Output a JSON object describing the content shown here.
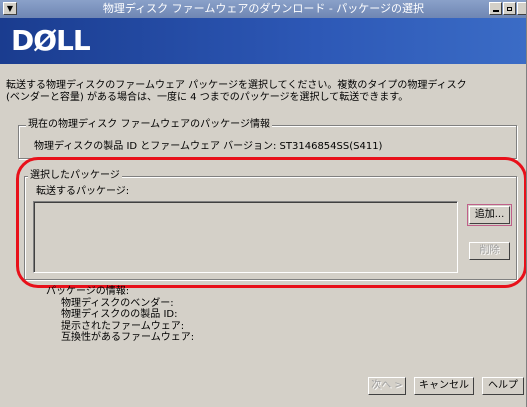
{
  "window": {
    "title": "物理ディスク ファームウェアのダウンロード - パッケージの選択",
    "system_menu_icon": "chevron-down-icon",
    "controls": [
      "minimize-icon",
      "maximize-icon"
    ]
  },
  "banner": {
    "logo": "DØLL"
  },
  "description": {
    "line1": "転送する物理ディスクのファームウェア パッケージを選択してください。複数のタイプの物理ディスク",
    "line2": "(ベンダーと容量) がある場合は、一度に 4 つまでのパッケージを選択して転送できます。"
  },
  "current_package": {
    "legend": "現在の物理ディスク ファームウェアのパッケージ情報",
    "info": "物理ディスクの製品 ID とファームウェア バージョン: ST3146854SS(S411)"
  },
  "selected_packages": {
    "legend": "選択したパッケージ",
    "list_label": "転送するパッケージ:",
    "add_button": "追加...",
    "remove_button": "削除"
  },
  "package_info": {
    "heading": "パッケージの情報:",
    "vendor": "物理ディスクのベンダー:",
    "product_id": "物理ディスクのの製品 ID:",
    "offered_fw": "提示されたファームウェア:",
    "compatible_fw": "互換性があるファームウェア:"
  },
  "footer": {
    "next_button": "次へ >",
    "cancel_button": "キャンセル",
    "help_button": "ヘルプ"
  },
  "colors": {
    "banner": "#2d58b6",
    "highlight": "#e8101a",
    "face": "#d4d0c8"
  }
}
